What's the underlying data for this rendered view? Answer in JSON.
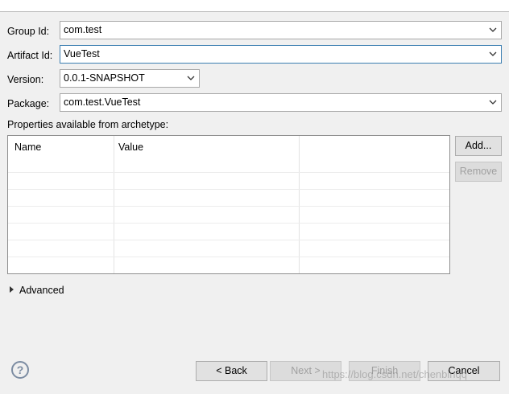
{
  "form": {
    "group_id": {
      "label": "Group Id:",
      "value": "com.test"
    },
    "artifact_id": {
      "label": "Artifact Id:",
      "value": "VueTest"
    },
    "version": {
      "label": "Version:",
      "value": "0.0.1-SNAPSHOT"
    },
    "package": {
      "label": "Package:",
      "value": "com.test.VueTest"
    }
  },
  "properties": {
    "title": "Properties available from archetype:",
    "columns": [
      "Name",
      "Value"
    ],
    "add_label": "Add...",
    "remove_label": "Remove"
  },
  "advanced": {
    "label": "Advanced"
  },
  "footer": {
    "help_icon": "?",
    "back_label": "< Back",
    "next_label": "Next >",
    "finish_label": "Finish",
    "cancel_label": "Cancel"
  },
  "watermark": "https://blog.csdn.net/chenbinqq",
  "colors": {
    "focus_border": "#3c7fb1",
    "background": "#f0f0f0"
  },
  "icons": {
    "dropdown": "chevron-down-icon",
    "advanced": "triangle-right-icon",
    "help": "help-icon"
  }
}
